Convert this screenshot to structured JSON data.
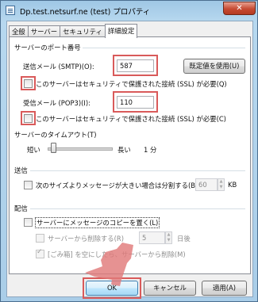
{
  "window": {
    "title": "Dp.test.netsurf.ne (test) プロパティ",
    "close_label": "✕"
  },
  "tabs": [
    {
      "label": "全般"
    },
    {
      "label": "サーバー"
    },
    {
      "label": "セキュリティ"
    },
    {
      "label": "詳細設定"
    }
  ],
  "server_ports": {
    "heading": "サーバーのポート番号",
    "smtp_label": "送信メール (SMTP)(O):",
    "smtp_value": "587",
    "defaults_button": "既定値を使用(U)",
    "smtp_ssl_label": "このサーバーはセキュリティで保護された接続 (SSL) が必要(Q)",
    "pop3_label": "受信メール (POP3)(I):",
    "pop3_value": "110",
    "pop3_ssl_label": "このサーバーはセキュリティで保護された接続 (SSL) が必要(C)"
  },
  "timeout": {
    "heading": "サーバーのタイムアウト(T)",
    "short_label": "短い",
    "long_label": "長い",
    "value_label": "1 分",
    "position": 0.05
  },
  "send": {
    "heading": "送信",
    "split_label": "次のサイズよりメッセージが大きい場合は分割する(B)",
    "split_value": "60",
    "split_unit": "KB"
  },
  "delivery": {
    "heading": "配信",
    "leave_copy_label": "サーバーにメッセージのコピーを置く(L)",
    "remove_after_label": "サーバーから削除する(R)",
    "remove_after_value": "5",
    "remove_after_unit": "日後",
    "remove_deleted_label": "[ごみ箱] を空にしたら、サーバーから削除(M)"
  },
  "footer": {
    "ok": "OK",
    "cancel": "キャンセル",
    "apply": "適用(A)"
  },
  "colors": {
    "highlight": "#d95a5a",
    "arrow": "#e07a7a"
  }
}
